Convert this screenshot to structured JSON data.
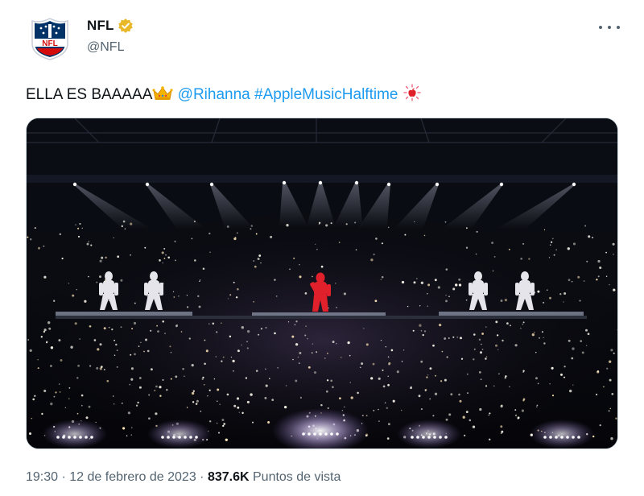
{
  "author": {
    "name": "NFL",
    "handle": "@NFL",
    "verified_badge": "gold-verified-badge",
    "avatar_icon": "nfl-shield-logo",
    "avatar_text": "NFL"
  },
  "tweet": {
    "text_prefix": "ELLA ES BAAAAA",
    "mention": "@Rihanna",
    "hashtag": "#AppleMusicHalftime",
    "emojis": [
      "crown-emoji",
      "apple-music-halftime-icon"
    ]
  },
  "footer": {
    "time": "19:30",
    "separator1": " · ",
    "date": "12 de febrero de 2023",
    "separator2": " · ",
    "views_count": "837.6K",
    "views_label": " Puntos de vista"
  },
  "colors": {
    "link": "#1d9bf0",
    "secondary_text": "#536471",
    "verified_gold": "#e8b829",
    "performer_red": "#e0202a"
  },
  "more_menu_icon": "more-options-icon"
}
